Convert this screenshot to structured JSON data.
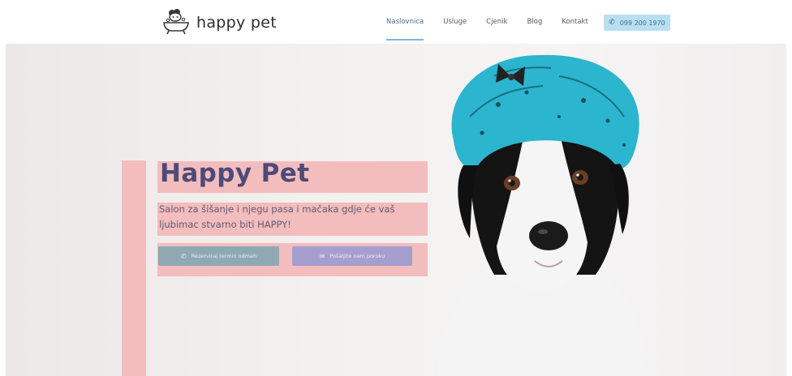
{
  "brand": {
    "name": "happy pet",
    "logo_icon": "bathtub-dog-icon"
  },
  "nav": {
    "items": [
      {
        "label": "Naslovnica",
        "active": true
      },
      {
        "label": "Usluge",
        "active": false
      },
      {
        "label": "Cjenik",
        "active": false
      },
      {
        "label": "Blog",
        "active": false
      },
      {
        "label": "Kontakt",
        "active": false
      }
    ],
    "phone": {
      "label": "099 200 1970",
      "icon": "phone-icon"
    }
  },
  "hero": {
    "title": "Happy Pet",
    "subtitle": "Salon za šišanje i njegu pasa i mačaka gdje će vaš ljubimac stvarno biti HAPPY!",
    "buttons": [
      {
        "label": "Rezerviraj termin odmah",
        "icon": "phone-icon"
      },
      {
        "label": "Pošaljite nam poruku",
        "icon": "mail-icon"
      }
    ]
  },
  "colors": {
    "accent_pink": "#f3bdbd",
    "title_text": "#4d4a7a",
    "phone_button": "#b9dff0",
    "booking_button": "#8fa9b3",
    "inquiry_button": "#a79ed0",
    "hat_blue": "#2bb5cf"
  }
}
